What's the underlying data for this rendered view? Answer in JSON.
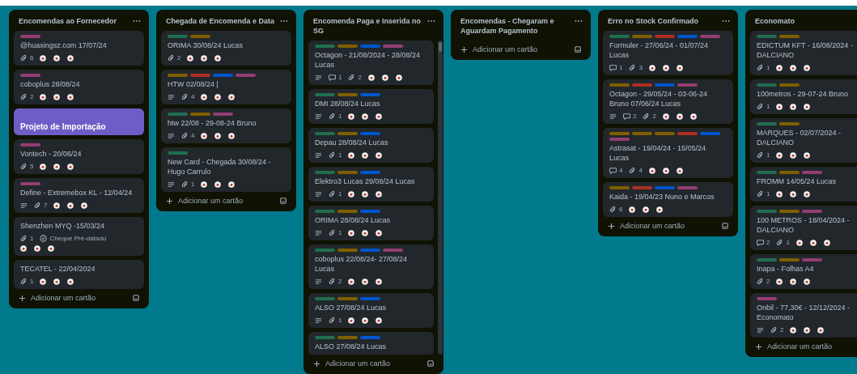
{
  "lists": [
    {
      "title": "Encomendas ao Fornecedor",
      "menu": true,
      "template": true,
      "add_label": "Adicionar um cartão",
      "cards": [
        {
          "kind": "card",
          "labels": [
            {
              "color": "#943d73"
            }
          ],
          "title": "@huaxingsz.com 17/07/24",
          "description": false,
          "attachments": "6",
          "members": true
        },
        {
          "kind": "card",
          "labels": [
            {
              "color": "#943d73"
            }
          ],
          "title": "coboplus 28/08/24",
          "description": false,
          "attachments": "2",
          "members": true
        },
        {
          "kind": "cover",
          "title": "Projeto de Importação"
        },
        {
          "kind": "card",
          "labels": [
            {
              "color": "#943d73"
            }
          ],
          "title": "Vontech - 20/06/24",
          "description": false,
          "attachments": "5",
          "members": true
        },
        {
          "kind": "card",
          "labels": [
            {
              "color": "#943d73"
            }
          ],
          "title": "Define - Extremebox KL - 12/04/24",
          "description": true,
          "attachments": "7",
          "members": true
        },
        {
          "kind": "card",
          "title": "Shenzhen MYQ -15/03/24",
          "description": false,
          "attachments": "1",
          "field": "Cheque Pré-datado",
          "members": true
        },
        {
          "kind": "card",
          "title": "TECATEL - 22/04/2024",
          "description": false,
          "attachments": "1",
          "members": true
        }
      ]
    },
    {
      "title": "Chegada de Encomenda e Data",
      "menu": true,
      "template": true,
      "add_label": "Adicionar um cartão",
      "cards": [
        {
          "kind": "card",
          "labels": [
            {
              "color": "#216e4e"
            },
            {
              "color": "#7f5f01"
            }
          ],
          "title": "ORIMA 30/08/24 Lucas",
          "description": false,
          "attachments": "2",
          "members": true
        },
        {
          "kind": "card",
          "labels": [
            {
              "color": "#7f5f01"
            },
            {
              "color": "#ae2e24"
            },
            {
              "color": "#0055cc"
            },
            {
              "color": "#943d73"
            }
          ],
          "title": "HTW 02/08/24 |",
          "description": true,
          "attachments": "4",
          "members": true
        },
        {
          "kind": "card",
          "labels": [
            {
              "color": "#216e4e"
            },
            {
              "color": "#7f5f01"
            },
            {
              "color": "#943d73"
            }
          ],
          "title": "htw 22/08 - 29-08-24 Bruno",
          "description": true,
          "attachments": "4",
          "members": true
        },
        {
          "kind": "card",
          "labels": [
            {
              "color": "#216e4e"
            }
          ],
          "title": "New Card - Chegada 30/08/24 - Hugo Carrulo",
          "description": true,
          "attachments": "1",
          "members": true
        }
      ]
    },
    {
      "title": "Encomenda Paga e Inserida no SG",
      "menu": true,
      "template": true,
      "scroll": true,
      "add_label": "Adicionar um cartão",
      "cards": [
        {
          "kind": "card",
          "labels": [
            {
              "color": "#216e4e"
            },
            {
              "color": "#7f5f01"
            },
            {
              "color": "#0055cc"
            },
            {
              "color": "#943d73"
            }
          ],
          "title": "Octagon - 21/08/2024 - 28/08/24 Lucas",
          "description": true,
          "comments": "1",
          "attachments": "2",
          "members": true
        },
        {
          "kind": "card",
          "labels": [
            {
              "color": "#216e4e"
            },
            {
              "color": "#7f5f01"
            },
            {
              "color": "#0055cc"
            }
          ],
          "title": "DMI 28/08/24 Lucas",
          "description": true,
          "attachments": "1",
          "members": true
        },
        {
          "kind": "card",
          "labels": [
            {
              "color": "#216e4e"
            },
            {
              "color": "#7f5f01"
            },
            {
              "color": "#0055cc"
            }
          ],
          "title": "Depau 28/08/24 Lucas",
          "description": true,
          "attachments": "1",
          "members": true
        },
        {
          "kind": "card",
          "labels": [
            {
              "color": "#216e4e"
            },
            {
              "color": "#7f5f01"
            },
            {
              "color": "#0055cc"
            }
          ],
          "title": "Elektro3 Lucas 29/08/24 Lucas",
          "description": true,
          "attachments": "1",
          "members": true
        },
        {
          "kind": "card",
          "labels": [
            {
              "color": "#216e4e"
            },
            {
              "color": "#7f5f01"
            },
            {
              "color": "#0055cc"
            }
          ],
          "title": "ORIMA 28/08/24 Lucas",
          "description": true,
          "attachments": "1",
          "members": true
        },
        {
          "kind": "card",
          "labels": [
            {
              "color": "#216e4e"
            },
            {
              "color": "#7f5f01"
            },
            {
              "color": "#0055cc"
            },
            {
              "color": "#943d73"
            }
          ],
          "title": "coboplus 22/08/24- 27/08/24 Lucas",
          "description": true,
          "attachments": "2",
          "members": true
        },
        {
          "kind": "card",
          "labels": [
            {
              "color": "#216e4e"
            },
            {
              "color": "#7f5f01"
            },
            {
              "color": "#0055cc"
            }
          ],
          "title": "ALSO 27/08/24 Lucas",
          "description": true,
          "attachments": "1",
          "members": true
        },
        {
          "kind": "card",
          "labels": [
            {
              "color": "#216e4e"
            },
            {
              "color": "#7f5f01"
            },
            {
              "color": "#0055cc"
            }
          ],
          "title": "ALSO 27/08/24 Lucas",
          "description": false,
          "members": false
        }
      ]
    },
    {
      "title": "Encomendas - Chegaram e Aguardam Pagamento",
      "menu": true,
      "template": true,
      "add_label": "Adicionar um cartão"
    },
    {
      "title": "Erro no Stock Confirmado",
      "menu": true,
      "template": true,
      "add_label": "Adicionar um cartão",
      "cards": [
        {
          "kind": "card",
          "labels": [
            {
              "color": "#216e4e"
            },
            {
              "color": "#7f5f01"
            },
            {
              "color": "#ae2e24"
            },
            {
              "color": "#0055cc"
            },
            {
              "color": "#943d73"
            }
          ],
          "title": "Formuler - 27/06/24 - 01/07/24 Lucas",
          "description": false,
          "comments": "1",
          "attachments": "3",
          "members": true
        },
        {
          "kind": "card",
          "labels": [
            {
              "color": "#7f5f01"
            },
            {
              "color": "#ae2e24"
            },
            {
              "color": "#0055cc"
            },
            {
              "color": "#943d73"
            }
          ],
          "title": "Octagon - 29/05/24 - 03-06-24 Bruno 07/06/24 Lucas",
          "description": true,
          "comments": "2",
          "attachments": "2",
          "members": true
        },
        {
          "kind": "card",
          "labels": [
            {
              "color": "#7f5f01"
            },
            {
              "color": "#7f5f01"
            },
            {
              "color": "#7f5f01"
            },
            {
              "color": "#ae2e24"
            },
            {
              "color": "#0055cc"
            },
            {
              "color": "#943d73"
            }
          ],
          "title": "Astrasat - 19/04/24 - 15/05/24 Lucas",
          "description": false,
          "comments": "4",
          "attachments": "4",
          "members": true
        },
        {
          "kind": "card",
          "labels": [
            {
              "color": "#7f5f01"
            },
            {
              "color": "#ae2e24"
            },
            {
              "color": "#0055cc"
            },
            {
              "color": "#943d73"
            }
          ],
          "title": "Kaida - 19/04/23 Nuno e Marcos",
          "description": false,
          "attachments": "6",
          "members": true
        }
      ]
    },
    {
      "title": "Economato",
      "menu": false,
      "template": false,
      "add_label": "Adicionar um cartão",
      "cards": [
        {
          "kind": "card",
          "labels": [
            {
              "color": "#216e4e"
            },
            {
              "color": "#7f5f01"
            }
          ],
          "title": "EDICTUM KFT - 16/08/2024 - DALCIANO",
          "description": false,
          "attachments": "1",
          "members": true
        },
        {
          "kind": "card",
          "labels": [
            {
              "color": "#216e4e"
            },
            {
              "color": "#7f5f01"
            }
          ],
          "title": "100metros - 29-07-24 Bruno",
          "description": false,
          "attachments": "1",
          "members": true
        },
        {
          "kind": "card",
          "labels": [
            {
              "color": "#216e4e"
            },
            {
              "color": "#7f5f01"
            }
          ],
          "title": "MARQUES - 02/07/2024 - DALCIANO",
          "description": false,
          "attachments": "1",
          "members": true
        },
        {
          "kind": "card",
          "labels": [
            {
              "color": "#216e4e"
            },
            {
              "color": "#7f5f01"
            },
            {
              "color": "#943d73"
            }
          ],
          "title": "FROMM 14/05/24 Lucas",
          "description": false,
          "attachments": "1",
          "members": true
        },
        {
          "kind": "card",
          "labels": [
            {
              "color": "#216e4e"
            },
            {
              "color": "#7f5f01"
            },
            {
              "color": "#943d73"
            }
          ],
          "title": "100 METROS - 18/04/2024 - DALCIANO",
          "description": false,
          "comments": "2",
          "attachments": "1",
          "members": true
        },
        {
          "kind": "card",
          "labels": [
            {
              "color": "#216e4e"
            },
            {
              "color": "#7f5f01"
            },
            {
              "color": "#943d73"
            }
          ],
          "title": "Inapa - Folhas A4",
          "description": false,
          "attachments": "2",
          "members": true
        },
        {
          "kind": "card",
          "labels": [
            {
              "color": "#943d73"
            }
          ],
          "title": "Onbil - 77,30€ - 12/12/2024 - Economato",
          "description": true,
          "attachments": "2",
          "members": true
        }
      ]
    }
  ]
}
